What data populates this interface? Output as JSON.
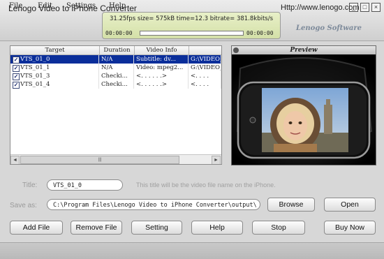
{
  "menu": [
    "File",
    "Edit",
    "Settings",
    "Help"
  ],
  "window_controls": [
    "_",
    "□",
    "×"
  ],
  "status": {
    "text": "31.25fps size=   575kB time=12.3 bitrate= 381.8kbits/s",
    "start_time": "00:00:00",
    "end_time": "00:00:00",
    "progress": 0
  },
  "brand": "Lenogo Software",
  "grid": {
    "columns": [
      "Target",
      "Duration",
      "Video Info",
      ""
    ],
    "rows": [
      {
        "checked": true,
        "target": "VTS_01_0",
        "duration": "N/A",
        "video_info": "Subtitle: dv...",
        "path": "G:\\VIDEO_",
        "selected": true
      },
      {
        "checked": true,
        "target": "VTS_01_1",
        "duration": "N/A",
        "video_info": "Video: mpeg2...",
        "path": "G:\\VIDEO_",
        "selected": false
      },
      {
        "checked": true,
        "target": "VTS_01_3",
        "duration": "Checki...",
        "video_info": "<. . . . . .>",
        "path": "<. . . .",
        "selected": false
      },
      {
        "checked": true,
        "target": "VTS_01_4",
        "duration": "Checki...",
        "video_info": "<. . . . . .>",
        "path": "<. . . .",
        "selected": false
      }
    ],
    "scroll_left": "◄",
    "scroll_right": "►",
    "scroll_thumb": "|||"
  },
  "preview": {
    "title": "Preview"
  },
  "form": {
    "title_label": "Title:",
    "title_value": "VTS_01_0",
    "title_hint": "This title will be the video file name on the iPhone.",
    "saveas_label": "Save as:",
    "saveas_value": "C:\\Program Files\\Lenogo Video to iPhone Converter\\output\\",
    "browse_label": "Browse",
    "open_label": "Open"
  },
  "actions": [
    "Add File",
    "Remove File",
    "Setting",
    "Help",
    "Stop",
    "Buy Now"
  ],
  "footer": {
    "app_name": "Lenogo Video to  iPhone Converter",
    "url": "Http://www.lenogo.com"
  }
}
